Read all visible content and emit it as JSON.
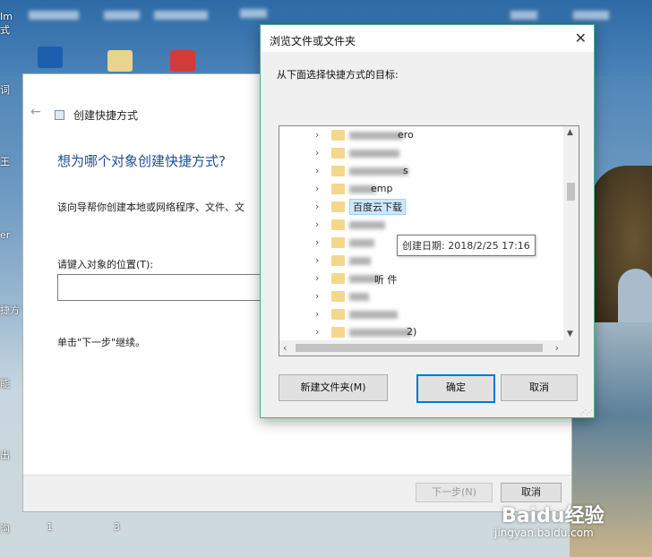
{
  "desktop": {
    "top_label": "Im",
    "edge_labels": [
      "式",
      "词",
      "王",
      "er",
      "捷方",
      "能",
      "出",
      "沟"
    ],
    "bottom_numbers": [
      "1",
      "3"
    ],
    "watermark": "Baidu经验",
    "watermark_url": "jingyan.baidu.com"
  },
  "wizard": {
    "title": "创建快捷方式",
    "heading": "想为哪个对象创建快捷方式?",
    "description": "该向导帮你创建本地或网络程序、文件、文",
    "location_label": "请键入对象的位置(T):",
    "location_value": "",
    "hint": "单击\"下一步\"继续。",
    "next_button": "下一步(N)",
    "cancel_button": "取消"
  },
  "browse_dialog": {
    "title": "浏览文件或文件夹",
    "instruction": "从下面选择快捷方式的目标:",
    "tree_items": [
      {
        "label": "ero",
        "blurred": true
      },
      {
        "label": "",
        "blurred": true
      },
      {
        "label": "s",
        "blurred": true
      },
      {
        "label": "emp",
        "blurred": true
      },
      {
        "label": "百度云下载",
        "blurred": false,
        "selected": true
      },
      {
        "label": "",
        "blurred": true
      },
      {
        "label": "",
        "blurred": true
      },
      {
        "label": "",
        "blurred": true
      },
      {
        "label": "听  件",
        "blurred": true
      },
      {
        "label": "",
        "blurred": true
      },
      {
        "label": "",
        "blurred": true
      },
      {
        "label": "2)",
        "blurred": true
      }
    ],
    "tooltip": "创建日期: 2018/2/25 17:16",
    "new_folder_button": "新建文件夹(M)",
    "ok_button": "确定",
    "cancel_button": "取消",
    "close_symbol": "✕",
    "scroll_fraction": 0.25
  },
  "colors": {
    "dialog_border": "#4caf7d",
    "ok_focus": "#0078d7",
    "heading_blue": "#1f4e94",
    "folder_yellow": "#f4d78a",
    "selection": "#cce8ff"
  }
}
